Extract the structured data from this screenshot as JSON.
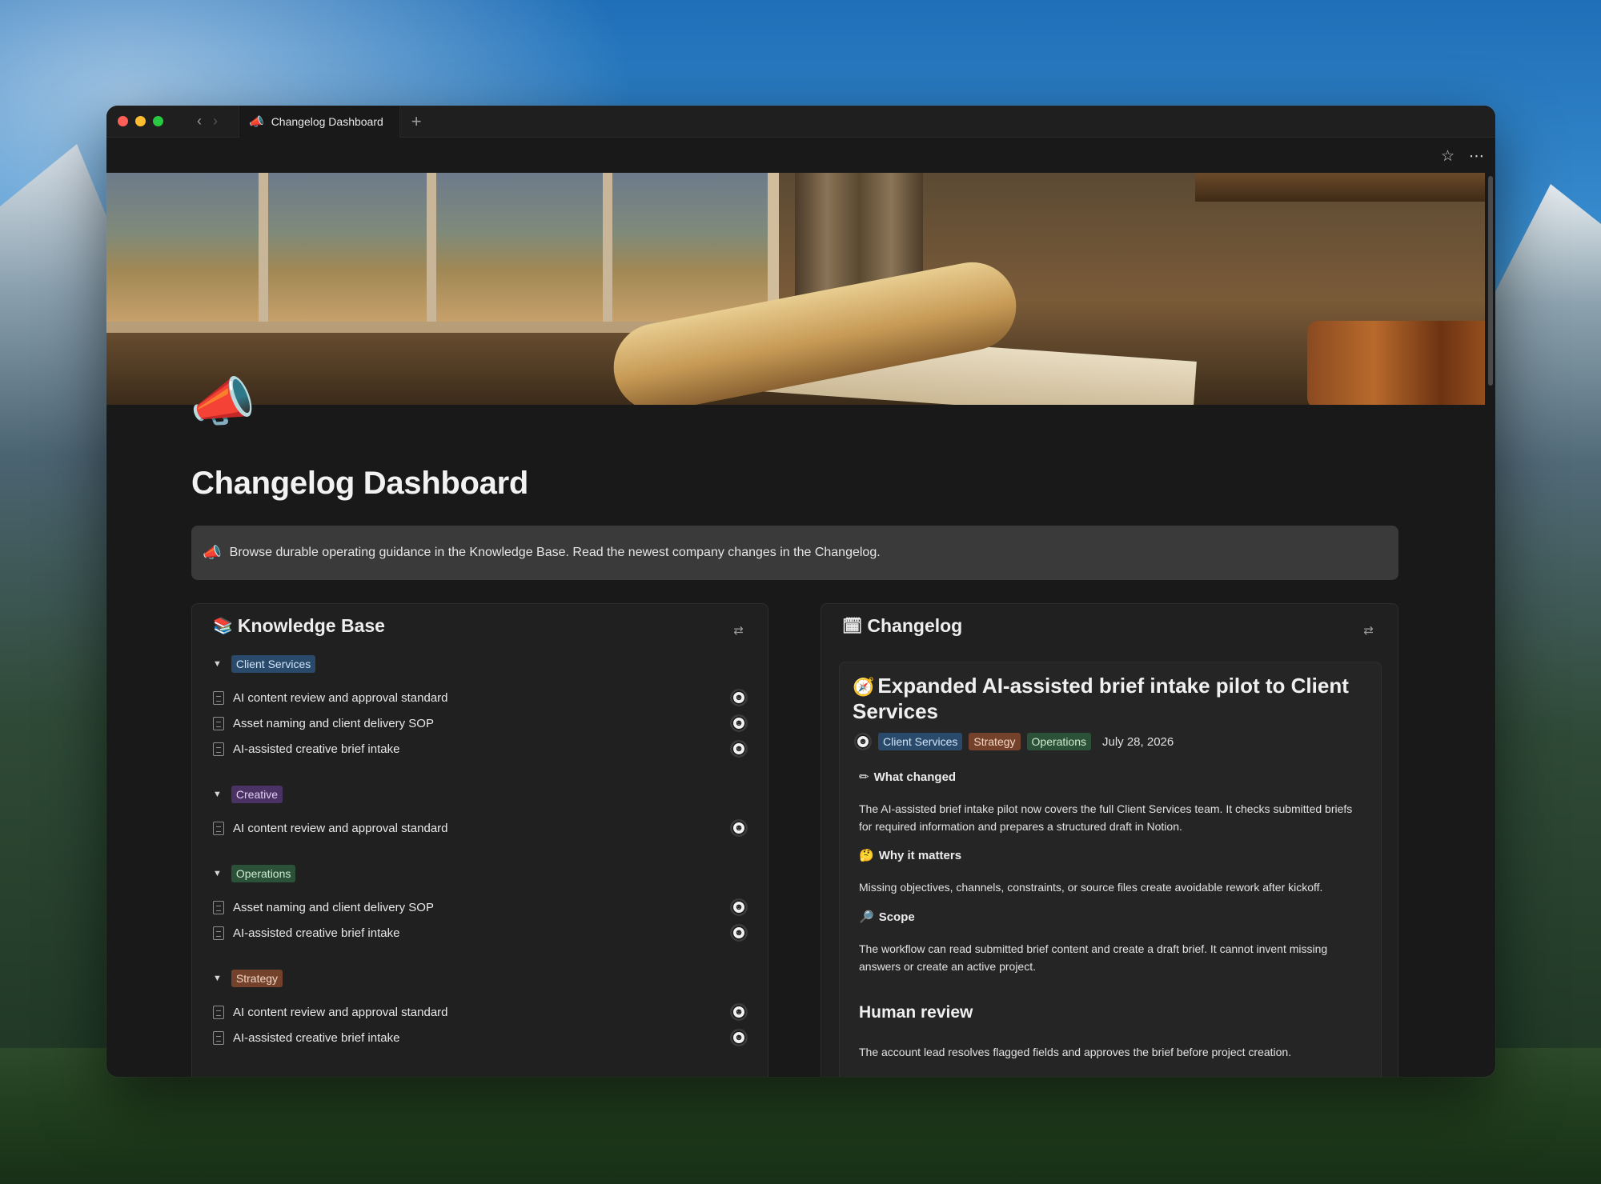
{
  "window": {
    "tab_title": "Changelog Dashboard",
    "tab_icon": "megaphone-icon",
    "new_tab_label": "+"
  },
  "page": {
    "title": "Changelog Dashboard",
    "callout": "Browse durable operating guidance in the Knowledge Base. Read the newest company changes in the Changelog."
  },
  "knowledge_base": {
    "title": "Knowledge Base",
    "groups": [
      {
        "tag": "Client Services",
        "color": "#2a4a6b",
        "items": [
          "AI content review and approval standard",
          "Asset naming and client delivery SOP",
          "AI-assisted creative brief intake"
        ]
      },
      {
        "tag": "Creative",
        "color": "#4a3264",
        "items": [
          "AI content review and approval standard"
        ]
      },
      {
        "tag": "Operations",
        "color": "#2b5138",
        "items": [
          "Asset naming and client delivery SOP",
          "AI-assisted creative brief intake"
        ]
      },
      {
        "tag": "Strategy",
        "color": "#74422a",
        "items": [
          "AI content review and approval standard",
          "AI-assisted creative brief intake"
        ]
      }
    ]
  },
  "changelog": {
    "title": "Changelog",
    "entry": {
      "title": "Expanded AI-assisted brief intake pilot to Client Services",
      "tags": [
        "Client Services",
        "Strategy",
        "Operations"
      ],
      "date": "July 28, 2026",
      "sections": [
        {
          "heading": "What changed",
          "body": "The AI-assisted brief intake pilot now covers the full Client Services team. It checks submitted briefs for required information and prepares a structured draft in Notion."
        },
        {
          "heading": "Why it matters",
          "body": "Missing objectives, channels, constraints, or source files create avoidable rework after kickoff."
        },
        {
          "heading": "Scope",
          "body": "The workflow can read submitted brief content and create a draft brief. It cannot invent missing answers or create an active project."
        }
      ],
      "subheading": "Human review",
      "subheading_body": "The account lead resolves flagged fields and approves the brief before project creation."
    }
  }
}
